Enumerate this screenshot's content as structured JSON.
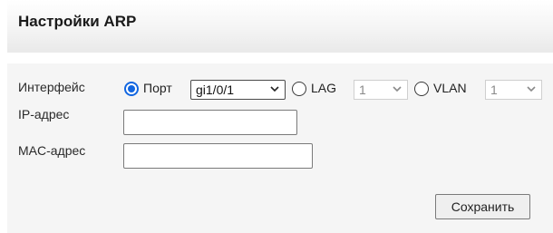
{
  "page": {
    "title": "Настройки ARP"
  },
  "form": {
    "interface_label": "Интерфейс",
    "interface_options": [
      {
        "label": "Порт",
        "selected": true,
        "select_value": "gi1/0/1",
        "enabled": true
      },
      {
        "label": "LAG",
        "selected": false,
        "select_value": "1",
        "enabled": false
      },
      {
        "label": "VLAN",
        "selected": false,
        "select_value": "1",
        "enabled": false
      }
    ],
    "ip_label": "IP-адрес",
    "ip_value": "",
    "mac_label": "MAC-адрес",
    "mac_value": "",
    "save_label": "Сохранить"
  },
  "colors": {
    "accent": "#1266e0",
    "panel_bg": "#f5f5f5"
  }
}
